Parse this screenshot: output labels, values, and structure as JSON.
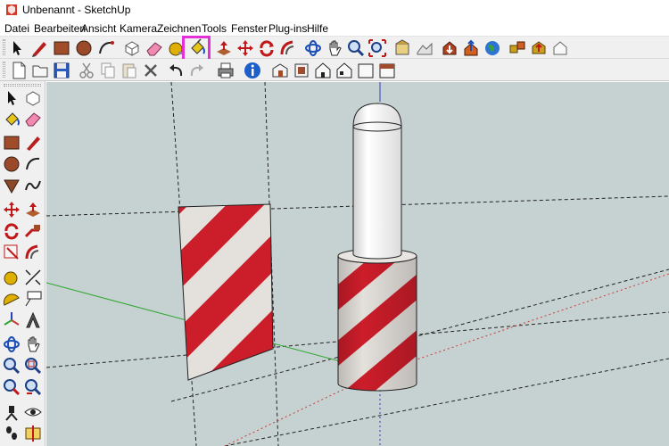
{
  "window": {
    "title": "Unbenannt - SketchUp"
  },
  "menu": {
    "items": [
      "Datei",
      "Bearbeiten",
      "Ansicht",
      "Kamera",
      "Zeichnen",
      "Tools",
      "Fenster",
      "Plug-ins",
      "Hilfe"
    ]
  },
  "toolbar_main": {
    "items": [
      "select-tool",
      "line-tool",
      "rectangle-tool",
      "circle-tool",
      "arc-tool",
      "make-component-tool",
      "eraser-tool",
      "tape-measure-tool",
      "paint-bucket-tool",
      "push-pull-tool",
      "move-tool",
      "rotate-tool",
      "offset-tool",
      "orbit-tool",
      "pan-tool",
      "zoom-tool",
      "zoom-extents-tool",
      "previous-view-tool",
      "add-location-tool",
      "get-models-tool",
      "share-model-tool",
      "3d-warehouse-tool",
      "extension-warehouse-tool",
      "share-component-tool"
    ],
    "active": "paint-bucket-tool"
  },
  "toolbar_standard": {
    "items": [
      "new-file",
      "open-file",
      "save-file",
      "cut",
      "copy",
      "paste",
      "erase",
      "undo",
      "redo",
      "print",
      "model-info",
      "iso-view",
      "top-view",
      "front-view",
      "right-view",
      "back-view",
      "left-view"
    ]
  },
  "left_toolbar": {
    "items": [
      "select-tool",
      "make-component-tool",
      "paint-bucket-tool",
      "eraser-tool",
      "rectangle-tool",
      "line-tool",
      "circle-tool",
      "arc-tool",
      "polygon-tool",
      "freehand-tool",
      "move-tool",
      "push-pull-tool",
      "rotate-tool",
      "follow-me-tool",
      "scale-tool",
      "offset-tool",
      "tape-measure-tool",
      "dimension-tool",
      "protractor-tool",
      "text-tool",
      "axes-tool",
      "3d-text-tool",
      "orbit-tool",
      "pan-tool",
      "zoom-tool",
      "zoom-window-tool",
      "zoom-extents-tool",
      "previous-view-tool",
      "position-camera-tool",
      "look-around-tool",
      "walk-tool",
      "section-plane-tool"
    ]
  },
  "colors": {
    "viewport_bg": "#c6d1d1",
    "stripe_red": "#cc1d2a",
    "stripe_white": "#e4e0dc",
    "highlight": "#e430d8",
    "axis_green": "#2fa82f",
    "axis_red": "#c83c3c",
    "axis_blue": "#2b3fbf"
  }
}
